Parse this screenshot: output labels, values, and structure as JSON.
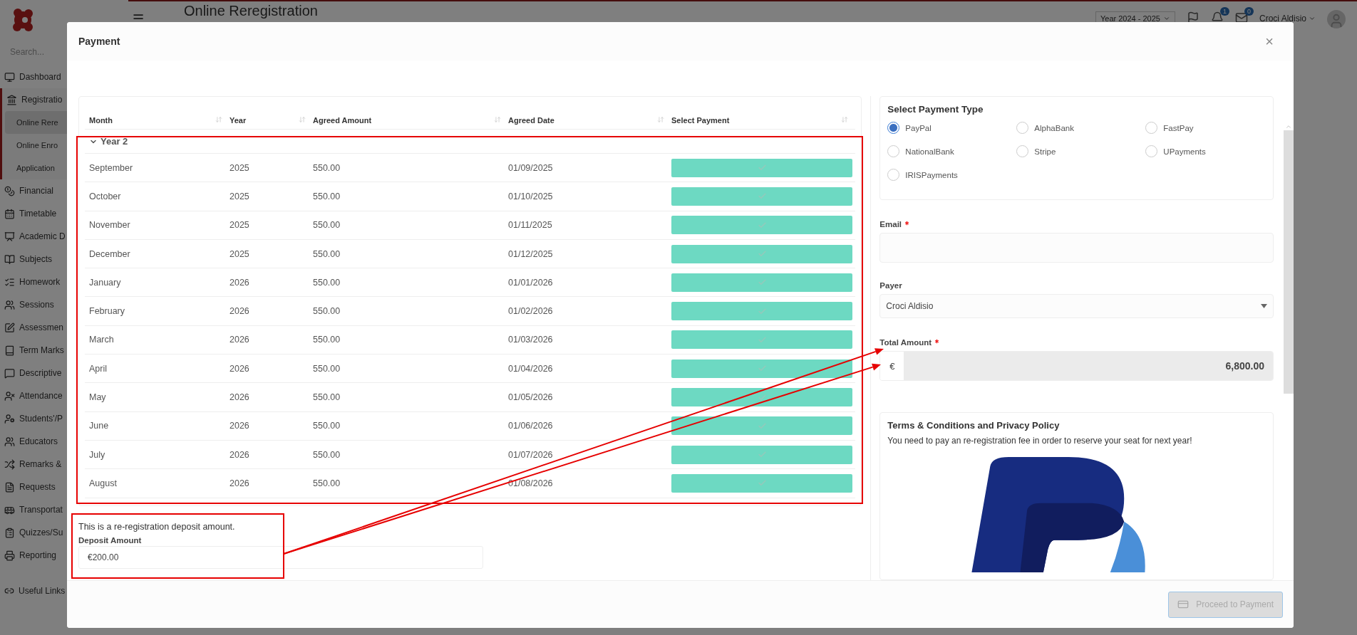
{
  "app": {
    "search": {
      "placeholder": "Search..."
    },
    "sidebar": {
      "items": [
        {
          "label": "Dashboard",
          "selected": false
        },
        {
          "label": "Registratio",
          "selected": false,
          "expanded": true,
          "children": [
            {
              "label": "Online Rere",
              "selected": true
            },
            {
              "label": "Online Enro",
              "selected": false
            },
            {
              "label": "Application",
              "selected": false
            }
          ]
        },
        {
          "label": "Financial",
          "selected": false
        },
        {
          "label": "Timetable",
          "selected": false
        },
        {
          "label": "Academic D",
          "selected": false
        },
        {
          "label": "Subjects",
          "selected": false
        },
        {
          "label": "Homework",
          "selected": false
        },
        {
          "label": "Sessions",
          "selected": false
        },
        {
          "label": "Assessmen",
          "selected": false
        },
        {
          "label": "Term Marks",
          "selected": false
        },
        {
          "label": "Descriptive",
          "selected": false
        },
        {
          "label": "Attendance",
          "selected": false
        },
        {
          "label": "Students'/P",
          "selected": false
        },
        {
          "label": "Educators",
          "selected": false
        },
        {
          "label": "Remarks &",
          "selected": false
        },
        {
          "label": "Requests",
          "selected": false
        },
        {
          "label": "Transportat",
          "selected": false
        },
        {
          "label": "Quizzes/Su",
          "selected": false
        },
        {
          "label": "Reporting",
          "selected": false
        }
      ],
      "footer_link": "Useful Links"
    },
    "header": {
      "menu": "☰",
      "title": "Online Reregistration",
      "year": "Year 2024 - 2025",
      "notifications": "1",
      "messages": "0",
      "user": "Croci Aldisio"
    }
  },
  "modal": {
    "title": "Payment",
    "close": "×",
    "table": {
      "columns": [
        "Month",
        "Year",
        "Agreed Amount",
        "Agreed Date",
        "Select Payment"
      ],
      "group": {
        "label": "Year 2",
        "expanded": true
      },
      "rows": [
        {
          "month": "September",
          "year": "2025",
          "amount": "550.00",
          "date": "01/09/2025",
          "selected": true
        },
        {
          "month": "October",
          "year": "2025",
          "amount": "550.00",
          "date": "01/10/2025",
          "selected": true
        },
        {
          "month": "November",
          "year": "2025",
          "amount": "550.00",
          "date": "01/11/2025",
          "selected": true
        },
        {
          "month": "December",
          "year": "2025",
          "amount": "550.00",
          "date": "01/12/2025",
          "selected": true
        },
        {
          "month": "January",
          "year": "2026",
          "amount": "550.00",
          "date": "01/01/2026",
          "selected": true
        },
        {
          "month": "February",
          "year": "2026",
          "amount": "550.00",
          "date": "01/02/2026",
          "selected": true
        },
        {
          "month": "March",
          "year": "2026",
          "amount": "550.00",
          "date": "01/03/2026",
          "selected": true
        },
        {
          "month": "April",
          "year": "2026",
          "amount": "550.00",
          "date": "01/04/2026",
          "selected": true
        },
        {
          "month": "May",
          "year": "2026",
          "amount": "550.00",
          "date": "01/05/2026",
          "selected": true
        },
        {
          "month": "June",
          "year": "2026",
          "amount": "550.00",
          "date": "01/06/2026",
          "selected": true
        },
        {
          "month": "July",
          "year": "2026",
          "amount": "550.00",
          "date": "01/07/2026",
          "selected": true
        },
        {
          "month": "August",
          "year": "2026",
          "amount": "550.00",
          "date": "01/08/2026",
          "selected": true
        }
      ]
    },
    "deposit": {
      "note": "This is a re-registration deposit amount.",
      "label": "Deposit Amount",
      "value": "€200.00"
    },
    "payment_type": {
      "title": "Select Payment Type",
      "options": [
        {
          "label": "PayPal",
          "selected": true
        },
        {
          "label": "AlphaBank",
          "selected": false
        },
        {
          "label": "FastPay",
          "selected": false
        },
        {
          "label": "NationalBank",
          "selected": false
        },
        {
          "label": "Stripe",
          "selected": false
        },
        {
          "label": "UPayments",
          "selected": false
        },
        {
          "label": "IRISPayments",
          "selected": false
        }
      ]
    },
    "email": {
      "label": "Email",
      "required": true
    },
    "payer": {
      "label": "Payer",
      "value": "Croci Aldisio"
    },
    "total": {
      "label": "Total Amount",
      "required": true,
      "currency": "€",
      "value": "6,800.00"
    },
    "terms": {
      "title": "Terms & Conditions and Privacy Policy",
      "text": "You need to pay an re-registration fee in order to reserve your seat for next year!"
    },
    "submit": {
      "label": "Proceed to Payment",
      "disabled": true
    }
  }
}
